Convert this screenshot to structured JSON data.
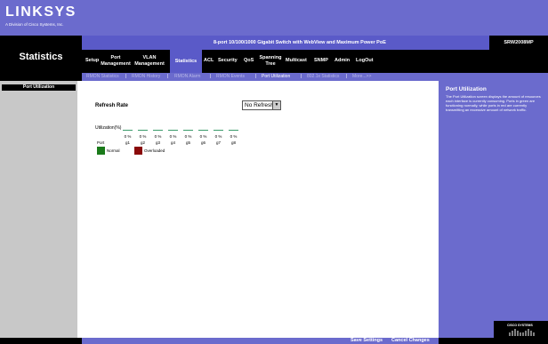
{
  "header": {
    "logo": "LINKSYS",
    "logo_sub": "A Division of Cisco Systems, Inc.",
    "product_description": "8-port 10/100/1000 Gigabit Switch with WebView and Maximum Power PoE",
    "model": "SRW2008MP",
    "section_title": "Statistics"
  },
  "nav": [
    {
      "label": "Setup"
    },
    {
      "label": "Port Management"
    },
    {
      "label": "VLAN Management"
    },
    {
      "label": "Statistics"
    },
    {
      "label": "ACL"
    },
    {
      "label": "Security"
    },
    {
      "label": "QoS"
    },
    {
      "label": "Spanning Tree"
    },
    {
      "label": "Multicast"
    },
    {
      "label": "SNMP"
    },
    {
      "label": "Admin"
    },
    {
      "label": "LogOut"
    }
  ],
  "subnav": [
    {
      "label": "RMON Statistics"
    },
    {
      "label": "RMON History"
    },
    {
      "label": "RMON Alarm"
    },
    {
      "label": "RMON Events"
    },
    {
      "label": "Port Utilization"
    },
    {
      "label": "802.1x Statistics"
    },
    {
      "label": "More...>>"
    }
  ],
  "sidebar": {
    "current": "Port Utilization"
  },
  "main": {
    "refresh_label": "Refresh Rate",
    "refresh_value": "No Refresh",
    "utilization_label": "Utilization(%)",
    "port_label": "Port",
    "ports": [
      {
        "name": "g1",
        "value": "0 %"
      },
      {
        "name": "g2",
        "value": "0 %"
      },
      {
        "name": "g3",
        "value": "0 %"
      },
      {
        "name": "g4",
        "value": "0 %"
      },
      {
        "name": "g5",
        "value": "0 %"
      },
      {
        "name": "g6",
        "value": "0 %"
      },
      {
        "name": "g7",
        "value": "0 %"
      },
      {
        "name": "g8",
        "value": "0 %"
      }
    ],
    "legend_normal": "Normal",
    "legend_overloaded": "Overloaded",
    "colors": {
      "normal": "#1a7a1a",
      "overloaded": "#8a0a0a",
      "bar": "#3a9a6a"
    }
  },
  "help": {
    "title": "Port Utilization",
    "body": "The Port Utilization screen displays the amount of resources each interface is currently consuming. Ports in green are functioning normally, while ports in red are currently transmitting an excessive amount of network traffic."
  },
  "footer": {
    "save_label": "Save Settings",
    "cancel_label": "Cancel Changes",
    "brand": "CISCO SYSTEMS"
  }
}
